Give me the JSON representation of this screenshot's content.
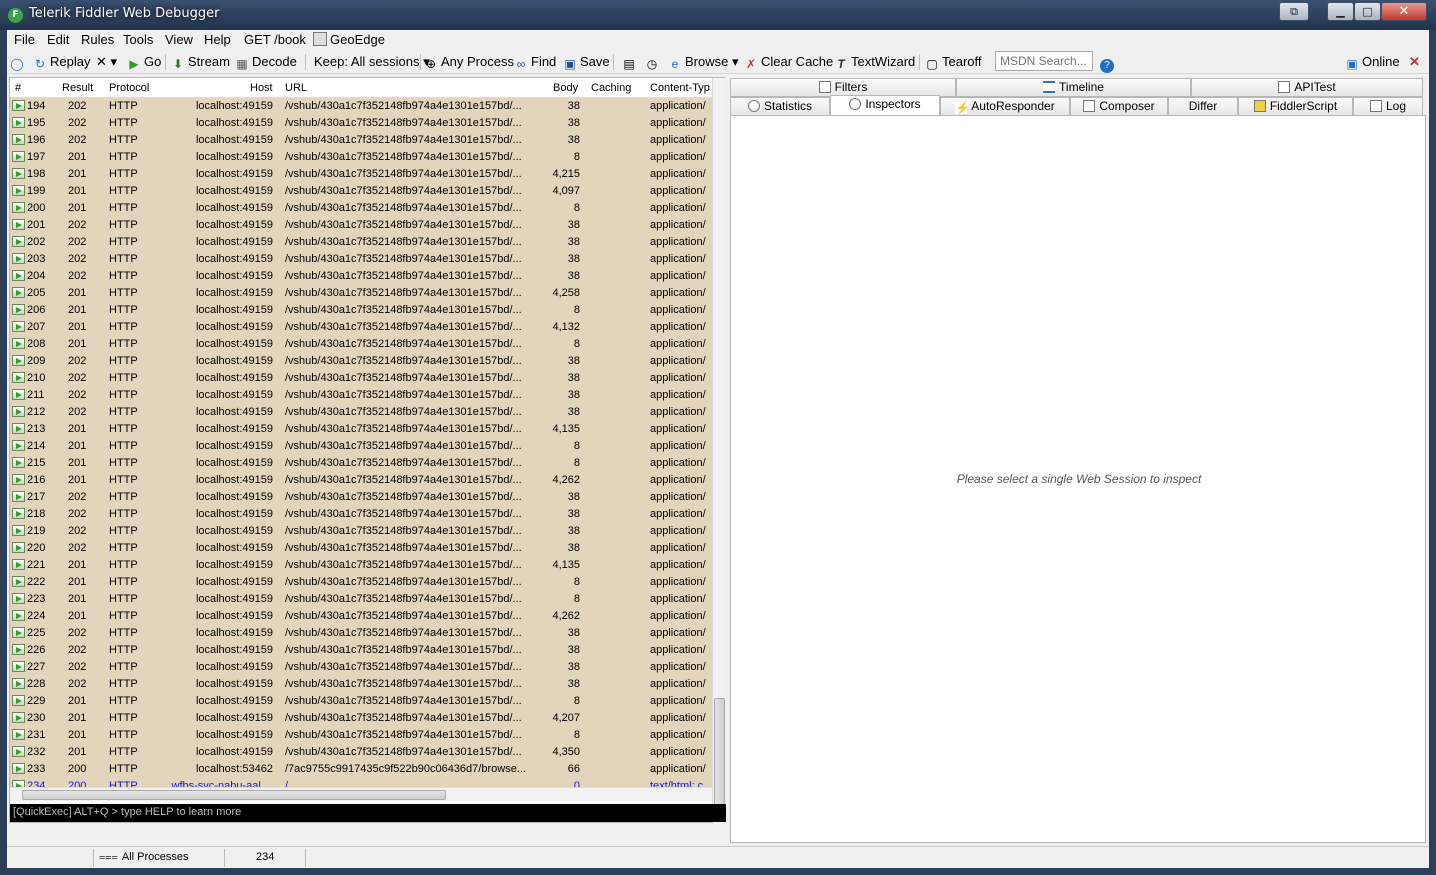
{
  "window": {
    "title": "Telerik Fiddler Web Debugger",
    "minimize": "▁",
    "maximize": "□",
    "close": "✕",
    "restore": "⧉"
  },
  "menu": [
    "File",
    "Edit",
    "Rules",
    "Tools",
    "View",
    "Help",
    "GET /book",
    "GeoEdge"
  ],
  "toolbar": {
    "replay": "Replay",
    "remove": "✕ ▾",
    "go": "Go",
    "stream": "Stream",
    "decode": "Decode",
    "keep": "Keep: All sessions ▾",
    "any_process": "Any Process",
    "find": "Find",
    "save": "Save",
    "browse": "Browse ▾",
    "clear_cache": "Clear Cache",
    "textwizard": "TextWizard",
    "tearoff": "Tearoff",
    "msdn_placeholder": "MSDN Search...",
    "online": "Online"
  },
  "columns": {
    "num": "#",
    "result": "Result",
    "protocol": "Protocol",
    "host": "Host",
    "url": "URL",
    "body": "Body",
    "caching": "Caching",
    "ctype": "Content-Typ"
  },
  "sessions": [
    {
      "num": "194",
      "result": "202",
      "protocol": "HTTP",
      "host": "localhost:49159",
      "url": "/vshub/430a1c7f352148fb974a4e1301e157bd/...",
      "body": "38",
      "ctype": "application/"
    },
    {
      "num": "195",
      "result": "202",
      "protocol": "HTTP",
      "host": "localhost:49159",
      "url": "/vshub/430a1c7f352148fb974a4e1301e157bd/...",
      "body": "38",
      "ctype": "application/"
    },
    {
      "num": "196",
      "result": "202",
      "protocol": "HTTP",
      "host": "localhost:49159",
      "url": "/vshub/430a1c7f352148fb974a4e1301e157bd/...",
      "body": "38",
      "ctype": "application/"
    },
    {
      "num": "197",
      "result": "201",
      "protocol": "HTTP",
      "host": "localhost:49159",
      "url": "/vshub/430a1c7f352148fb974a4e1301e157bd/...",
      "body": "8",
      "ctype": "application/"
    },
    {
      "num": "198",
      "result": "201",
      "protocol": "HTTP",
      "host": "localhost:49159",
      "url": "/vshub/430a1c7f352148fb974a4e1301e157bd/...",
      "body": "4,215",
      "ctype": "application/"
    },
    {
      "num": "199",
      "result": "201",
      "protocol": "HTTP",
      "host": "localhost:49159",
      "url": "/vshub/430a1c7f352148fb974a4e1301e157bd/...",
      "body": "4,097",
      "ctype": "application/"
    },
    {
      "num": "200",
      "result": "201",
      "protocol": "HTTP",
      "host": "localhost:49159",
      "url": "/vshub/430a1c7f352148fb974a4e1301e157bd/...",
      "body": "8",
      "ctype": "application/"
    },
    {
      "num": "201",
      "result": "202",
      "protocol": "HTTP",
      "host": "localhost:49159",
      "url": "/vshub/430a1c7f352148fb974a4e1301e157bd/...",
      "body": "38",
      "ctype": "application/"
    },
    {
      "num": "202",
      "result": "202",
      "protocol": "HTTP",
      "host": "localhost:49159",
      "url": "/vshub/430a1c7f352148fb974a4e1301e157bd/...",
      "body": "38",
      "ctype": "application/"
    },
    {
      "num": "203",
      "result": "202",
      "protocol": "HTTP",
      "host": "localhost:49159",
      "url": "/vshub/430a1c7f352148fb974a4e1301e157bd/...",
      "body": "38",
      "ctype": "application/"
    },
    {
      "num": "204",
      "result": "202",
      "protocol": "HTTP",
      "host": "localhost:49159",
      "url": "/vshub/430a1c7f352148fb974a4e1301e157bd/...",
      "body": "38",
      "ctype": "application/"
    },
    {
      "num": "205",
      "result": "201",
      "protocol": "HTTP",
      "host": "localhost:49159",
      "url": "/vshub/430a1c7f352148fb974a4e1301e157bd/...",
      "body": "4,258",
      "ctype": "application/"
    },
    {
      "num": "206",
      "result": "201",
      "protocol": "HTTP",
      "host": "localhost:49159",
      "url": "/vshub/430a1c7f352148fb974a4e1301e157bd/...",
      "body": "8",
      "ctype": "application/"
    },
    {
      "num": "207",
      "result": "201",
      "protocol": "HTTP",
      "host": "localhost:49159",
      "url": "/vshub/430a1c7f352148fb974a4e1301e157bd/...",
      "body": "4,132",
      "ctype": "application/"
    },
    {
      "num": "208",
      "result": "201",
      "protocol": "HTTP",
      "host": "localhost:49159",
      "url": "/vshub/430a1c7f352148fb974a4e1301e157bd/...",
      "body": "8",
      "ctype": "application/"
    },
    {
      "num": "209",
      "result": "202",
      "protocol": "HTTP",
      "host": "localhost:49159",
      "url": "/vshub/430a1c7f352148fb974a4e1301e157bd/...",
      "body": "38",
      "ctype": "application/"
    },
    {
      "num": "210",
      "result": "202",
      "protocol": "HTTP",
      "host": "localhost:49159",
      "url": "/vshub/430a1c7f352148fb974a4e1301e157bd/...",
      "body": "38",
      "ctype": "application/"
    },
    {
      "num": "211",
      "result": "202",
      "protocol": "HTTP",
      "host": "localhost:49159",
      "url": "/vshub/430a1c7f352148fb974a4e1301e157bd/...",
      "body": "38",
      "ctype": "application/"
    },
    {
      "num": "212",
      "result": "202",
      "protocol": "HTTP",
      "host": "localhost:49159",
      "url": "/vshub/430a1c7f352148fb974a4e1301e157bd/...",
      "body": "38",
      "ctype": "application/"
    },
    {
      "num": "213",
      "result": "201",
      "protocol": "HTTP",
      "host": "localhost:49159",
      "url": "/vshub/430a1c7f352148fb974a4e1301e157bd/...",
      "body": "4,135",
      "ctype": "application/"
    },
    {
      "num": "214",
      "result": "201",
      "protocol": "HTTP",
      "host": "localhost:49159",
      "url": "/vshub/430a1c7f352148fb974a4e1301e157bd/...",
      "body": "8",
      "ctype": "application/"
    },
    {
      "num": "215",
      "result": "201",
      "protocol": "HTTP",
      "host": "localhost:49159",
      "url": "/vshub/430a1c7f352148fb974a4e1301e157bd/...",
      "body": "8",
      "ctype": "application/"
    },
    {
      "num": "216",
      "result": "201",
      "protocol": "HTTP",
      "host": "localhost:49159",
      "url": "/vshub/430a1c7f352148fb974a4e1301e157bd/...",
      "body": "4,262",
      "ctype": "application/"
    },
    {
      "num": "217",
      "result": "202",
      "protocol": "HTTP",
      "host": "localhost:49159",
      "url": "/vshub/430a1c7f352148fb974a4e1301e157bd/...",
      "body": "38",
      "ctype": "application/"
    },
    {
      "num": "218",
      "result": "202",
      "protocol": "HTTP",
      "host": "localhost:49159",
      "url": "/vshub/430a1c7f352148fb974a4e1301e157bd/...",
      "body": "38",
      "ctype": "application/"
    },
    {
      "num": "219",
      "result": "202",
      "protocol": "HTTP",
      "host": "localhost:49159",
      "url": "/vshub/430a1c7f352148fb974a4e1301e157bd/...",
      "body": "38",
      "ctype": "application/"
    },
    {
      "num": "220",
      "result": "202",
      "protocol": "HTTP",
      "host": "localhost:49159",
      "url": "/vshub/430a1c7f352148fb974a4e1301e157bd/...",
      "body": "38",
      "ctype": "application/"
    },
    {
      "num": "221",
      "result": "201",
      "protocol": "HTTP",
      "host": "localhost:49159",
      "url": "/vshub/430a1c7f352148fb974a4e1301e157bd/...",
      "body": "4,135",
      "ctype": "application/"
    },
    {
      "num": "222",
      "result": "201",
      "protocol": "HTTP",
      "host": "localhost:49159",
      "url": "/vshub/430a1c7f352148fb974a4e1301e157bd/...",
      "body": "8",
      "ctype": "application/"
    },
    {
      "num": "223",
      "result": "201",
      "protocol": "HTTP",
      "host": "localhost:49159",
      "url": "/vshub/430a1c7f352148fb974a4e1301e157bd/...",
      "body": "8",
      "ctype": "application/"
    },
    {
      "num": "224",
      "result": "201",
      "protocol": "HTTP",
      "host": "localhost:49159",
      "url": "/vshub/430a1c7f352148fb974a4e1301e157bd/...",
      "body": "4,262",
      "ctype": "application/"
    },
    {
      "num": "225",
      "result": "202",
      "protocol": "HTTP",
      "host": "localhost:49159",
      "url": "/vshub/430a1c7f352148fb974a4e1301e157bd/...",
      "body": "38",
      "ctype": "application/"
    },
    {
      "num": "226",
      "result": "202",
      "protocol": "HTTP",
      "host": "localhost:49159",
      "url": "/vshub/430a1c7f352148fb974a4e1301e157bd/...",
      "body": "38",
      "ctype": "application/"
    },
    {
      "num": "227",
      "result": "202",
      "protocol": "HTTP",
      "host": "localhost:49159",
      "url": "/vshub/430a1c7f352148fb974a4e1301e157bd/...",
      "body": "38",
      "ctype": "application/"
    },
    {
      "num": "228",
      "result": "202",
      "protocol": "HTTP",
      "host": "localhost:49159",
      "url": "/vshub/430a1c7f352148fb974a4e1301e157bd/...",
      "body": "38",
      "ctype": "application/"
    },
    {
      "num": "229",
      "result": "201",
      "protocol": "HTTP",
      "host": "localhost:49159",
      "url": "/vshub/430a1c7f352148fb974a4e1301e157bd/...",
      "body": "8",
      "ctype": "application/"
    },
    {
      "num": "230",
      "result": "201",
      "protocol": "HTTP",
      "host": "localhost:49159",
      "url": "/vshub/430a1c7f352148fb974a4e1301e157bd/...",
      "body": "4,207",
      "ctype": "application/"
    },
    {
      "num": "231",
      "result": "201",
      "protocol": "HTTP",
      "host": "localhost:49159",
      "url": "/vshub/430a1c7f352148fb974a4e1301e157bd/...",
      "body": "8",
      "ctype": "application/"
    },
    {
      "num": "232",
      "result": "201",
      "protocol": "HTTP",
      "host": "localhost:49159",
      "url": "/vshub/430a1c7f352148fb974a4e1301e157bd/...",
      "body": "4,350",
      "ctype": "application/"
    },
    {
      "num": "233",
      "result": "200",
      "protocol": "HTTP",
      "host": "localhost:53462",
      "url": "/7ac9755c9917435c9f522b90c06436d7/browse...",
      "body": "66",
      "ctype": "application/"
    },
    {
      "num": "234",
      "result": "200",
      "protocol": "HTTP",
      "host": "wfbs-svc-nabu-aal....",
      "url": "/",
      "body": "0",
      "ctype": "text/html; c",
      "highlight": true
    }
  ],
  "tabs_top": {
    "filters": "Filters",
    "timeline": "Timeline",
    "apitest": "APITest"
  },
  "tabs_bottom": {
    "statistics": "Statistics",
    "inspectors": "Inspectors",
    "autoresponder": "AutoResponder",
    "composer": "Composer",
    "differ": "Differ",
    "fiddlerscript": "FiddlerScript",
    "log": "Log"
  },
  "inspector_message": "Please select a single Web Session to inspect",
  "quickexec": "[QuickExec] ALT+Q > type HELP to learn more",
  "status": {
    "processes": "All Processes",
    "count": "234"
  },
  "colors": {
    "session_bg": "#e2d5bb",
    "link_blue": "#1515e0",
    "close_red": "#c0392b"
  }
}
